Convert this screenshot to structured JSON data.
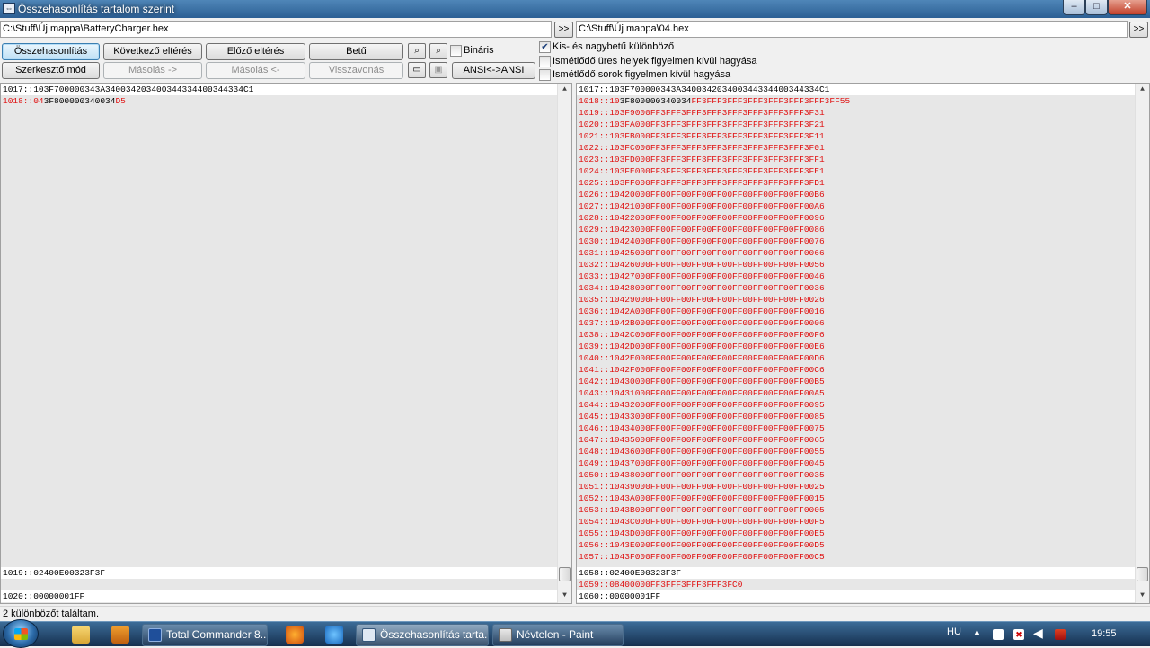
{
  "window": {
    "title": "Összehasonlítás tartalom szerint",
    "minimize": "–",
    "maximize": "□",
    "close": "✕"
  },
  "paths": {
    "left": "C:\\Stuff\\Új mappa\\BatteryCharger.hex",
    "right": "C:\\Stuff\\Új mappa\\04.hex",
    "browse_label": ">>"
  },
  "toolbar": {
    "compare": "Összehasonlítás",
    "next_diff": "Következő eltérés",
    "prev_diff": "Előző eltérés",
    "font": "Betű",
    "binary": "Bináris",
    "edit_mode": "Szerkesztő mód",
    "copy_right": "Másolás ->",
    "copy_left": "Másolás <-",
    "undo": "Visszavonás",
    "ansi": "ANSI<->ANSI"
  },
  "options": {
    "case_sensitive": "Kis- és nagybetű különböző",
    "ignore_spaces": "Ismétlődő üres helyek figyelmen kívül hagyása",
    "ignore_lines": "Ismétlődő sorok figyelmen kívül hagyása"
  },
  "left_pane": {
    "line1": "1017::103F700000343A340034203400344334400344334C1",
    "line2_prefix": "1018::",
    "line2_red1": "04",
    "line2_black": "3F800000340034",
    "line2_red2": "D5",
    "line3": "1019::02400E00323F3F",
    "line4": "1020::00000001FF"
  },
  "right_pane": {
    "line1": "1017::103F700000343A340034203400344334400344334C1",
    "line2_prefix": "1018::",
    "line2_red1": "10",
    "line2_black": "3F800000340034",
    "line2_red2": "FF3FFF3FFF3FFF3FFF3FFF3FFF3FF55",
    "diff_lines": [
      "1019::103F9000FF3FFF3FFF3FFF3FFF3FFF3FFF3FFF3F31",
      "1020::103FA000FF3FFF3FFF3FFF3FFF3FFF3FFF3FFF3F21",
      "1021::103FB000FF3FFF3FFF3FFF3FFF3FFF3FFF3FFF3F11",
      "1022::103FC000FF3FFF3FFF3FFF3FFF3FFF3FFF3FFF3F01",
      "1023::103FD000FF3FFF3FFF3FFF3FFF3FFF3FFF3FFF3FF1",
      "1024::103FE000FF3FFF3FFF3FFF3FFF3FFF3FFF3FFF3FE1",
      "1025::103FF000FF3FFF3FFF3FFF3FFF3FFF3FFF3FFF3FD1",
      "1026::10420000FF00FF00FF00FF00FF00FF00FF00FF00B6",
      "1027::10421000FF00FF00FF00FF00FF00FF00FF00FF00A6",
      "1028::10422000FF00FF00FF00FF00FF00FF00FF00FF0096",
      "1029::10423000FF00FF00FF00FF00FF00FF00FF00FF0086",
      "1030::10424000FF00FF00FF00FF00FF00FF00FF00FF0076",
      "1031::10425000FF00FF00FF00FF00FF00FF00FF00FF0066",
      "1032::10426000FF00FF00FF00FF00FF00FF00FF00FF0056",
      "1033::10427000FF00FF00FF00FF00FF00FF00FF00FF0046",
      "1034::10428000FF00FF00FF00FF00FF00FF00FF00FF0036",
      "1035::10429000FF00FF00FF00FF00FF00FF00FF00FF0026",
      "1036::1042A000FF00FF00FF00FF00FF00FF00FF00FF0016",
      "1037::1042B000FF00FF00FF00FF00FF00FF00FF00FF0006",
      "1038::1042C000FF00FF00FF00FF00FF00FF00FF00FF00F6",
      "1039::1042D000FF00FF00FF00FF00FF00FF00FF00FF00E6",
      "1040::1042E000FF00FF00FF00FF00FF00FF00FF00FF00D6",
      "1041::1042F000FF00FF00FF00FF00FF00FF00FF00FF00C6",
      "1042::10430000FF00FF00FF00FF00FF00FF00FF00FF00B5",
      "1043::10431000FF00FF00FF00FF00FF00FF00FF00FF00A5",
      "1044::10432000FF00FF00FF00FF00FF00FF00FF00FF0095",
      "1045::10433000FF00FF00FF00FF00FF00FF00FF00FF0085",
      "1046::10434000FF00FF00FF00FF00FF00FF00FF00FF0075",
      "1047::10435000FF00FF00FF00FF00FF00FF00FF00FF0065",
      "1048::10436000FF00FF00FF00FF00FF00FF00FF00FF0055",
      "1049::10437000FF00FF00FF00FF00FF00FF00FF00FF0045",
      "1050::10438000FF00FF00FF00FF00FF00FF00FF00FF0035",
      "1051::10439000FF00FF00FF00FF00FF00FF00FF00FF0025",
      "1052::1043A000FF00FF00FF00FF00FF00FF00FF00FF0015",
      "1053::1043B000FF00FF00FF00FF00FF00FF00FF00FF0005",
      "1054::1043C000FF00FF00FF00FF00FF00FF00FF00FF00F5",
      "1055::1043D000FF00FF00FF00FF00FF00FF00FF00FF00E5",
      "1056::1043E000FF00FF00FF00FF00FF00FF00FF00FF00D5",
      "1057::1043F000FF00FF00FF00FF00FF00FF00FF00FF00C5"
    ],
    "line_1058": "1058::02400E00323F3F",
    "line_1059": "1059::08400000FF3FFF3FFF3FFF3FC0",
    "line_1060": "1060::00000001FF"
  },
  "status": "2 különbözőt találtam.",
  "taskbar": {
    "tasks": [
      "Total Commander 8....",
      "Összehasonlítás tarta...",
      "Névtelen - Paint"
    ],
    "lang": "HU",
    "clock": "19:55"
  },
  "colors": {
    "diff_red": "#e01010",
    "title_blue": "#2c5f94"
  }
}
